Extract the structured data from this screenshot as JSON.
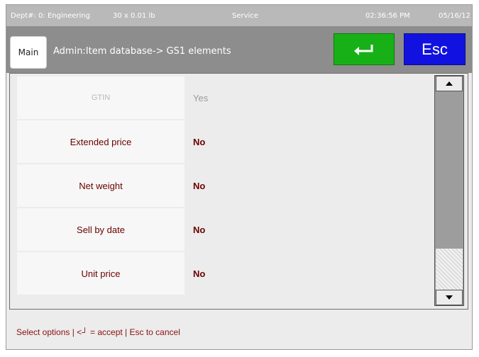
{
  "status": {
    "department": "Dept#: 0: Engineering",
    "tare": "30 x 0.01 lb",
    "mode": "Service",
    "time": "02:36:56 PM",
    "date": "05/16/12"
  },
  "header": {
    "main_label": "Main",
    "breadcrumb": "Admin:Item database-> GS1 elements",
    "enter_icon": "enter-arrow-icon",
    "esc_label": "Esc"
  },
  "rows": [
    {
      "label": "GTIN",
      "value": "Yes",
      "disabled": true
    },
    {
      "label": "Extended price",
      "value": "No"
    },
    {
      "label": "Net weight",
      "value": "No"
    },
    {
      "label": "Sell by date",
      "value": "No"
    },
    {
      "label": "Unit price",
      "value": "No"
    }
  ],
  "footer": {
    "hint": "Select options | <┘ = accept | Esc to cancel"
  },
  "colors": {
    "accept": "#17b117",
    "escape": "#1212e0",
    "option_text": "#6b0000"
  }
}
